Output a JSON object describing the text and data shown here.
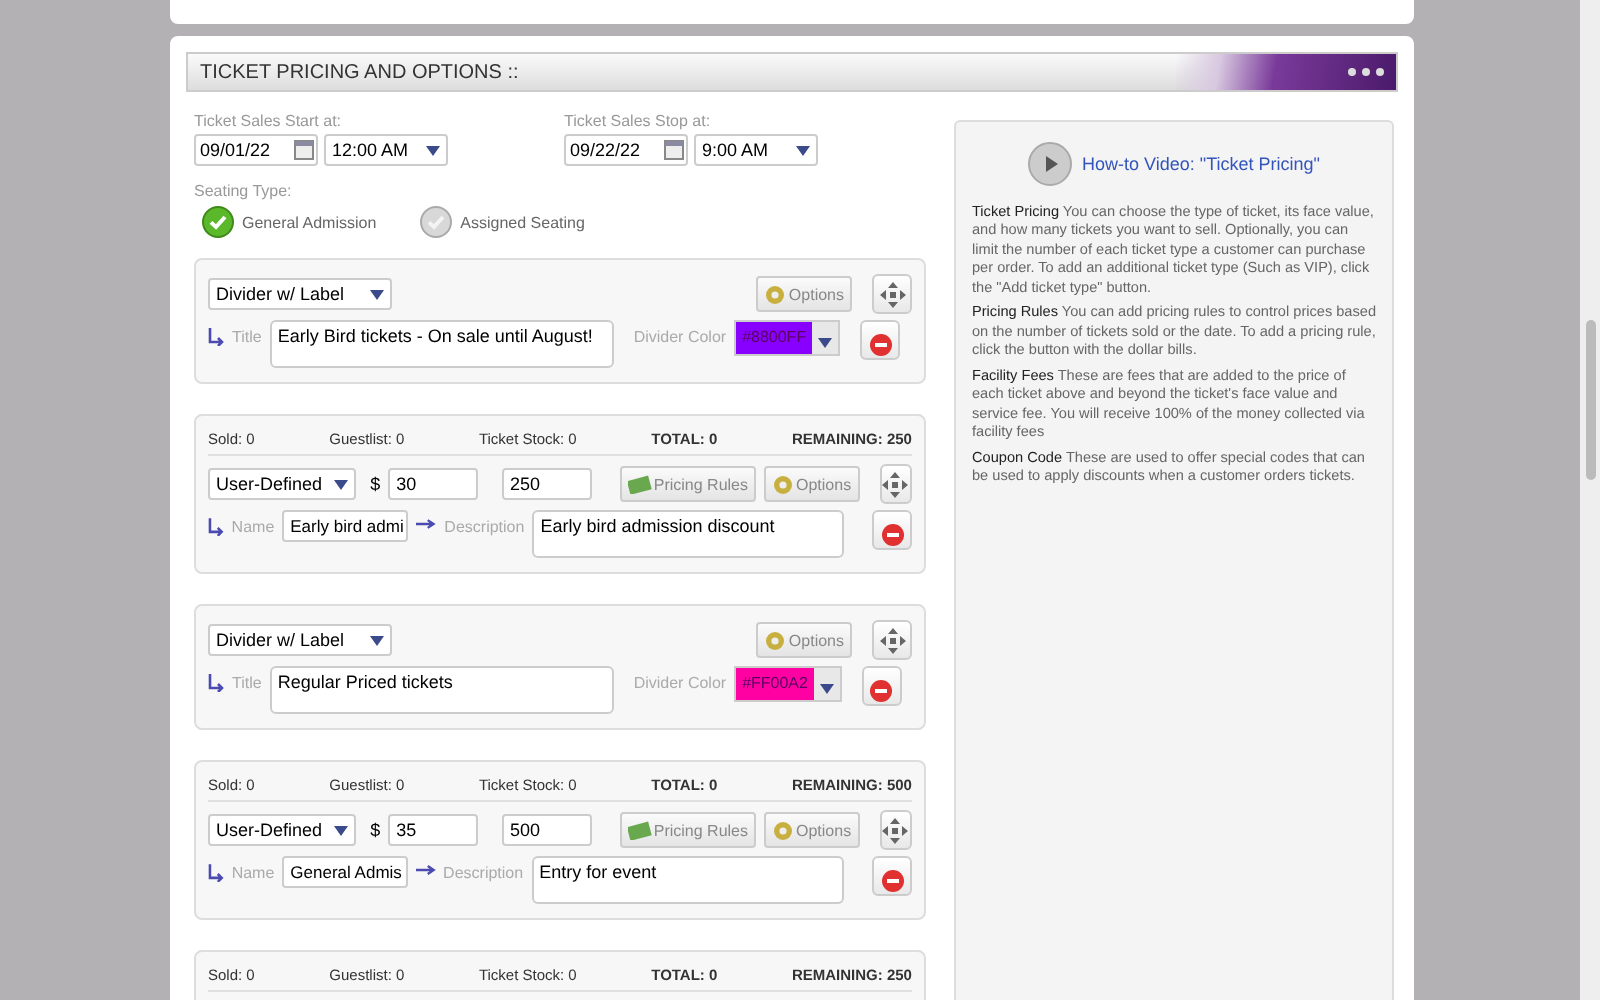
{
  "section": {
    "title": "TICKET PRICING AND OPTIONS ::"
  },
  "sales_start": {
    "label": "Ticket Sales Start at:",
    "date": "09/01/22",
    "time": "12:00 AM"
  },
  "sales_stop": {
    "label": "Ticket Sales Stop at:",
    "date": "09/22/22",
    "time": "9:00 AM"
  },
  "seating": {
    "label": "Seating Type:",
    "options": [
      {
        "label": "General Admission",
        "selected": true
      },
      {
        "label": "Assigned Seating",
        "selected": false
      }
    ]
  },
  "items": [
    {
      "kind": "divider",
      "type": "Divider w/ Label",
      "options_button": "Options",
      "title_label": "Title",
      "title": "Early Bird tickets - On sale until August!",
      "color_label": "Divider Color",
      "color": "#8800ff",
      "color_text": "#8800FF"
    },
    {
      "kind": "ticket",
      "sold": "Sold: 0",
      "guestlist": "Guestlist: 0",
      "stock": "Ticket Stock: 0",
      "total": "TOTAL: 0",
      "remaining": "REMAINING: 250",
      "type": "User-Defined",
      "currency": "$",
      "price": "30",
      "quantity": "250",
      "pricing_button": "Pricing Rules",
      "options_button": "Options",
      "name_label": "Name",
      "name": "Early bird admi",
      "description_label": "Description",
      "description": "Early bird admission discount"
    },
    {
      "kind": "divider",
      "type": "Divider w/ Label",
      "options_button": "Options",
      "title_label": "Title",
      "title": "Regular Priced tickets",
      "color_label": "Divider Color",
      "color": "#ff00a2",
      "color_text": "#FF00A2"
    },
    {
      "kind": "ticket",
      "sold": "Sold: 0",
      "guestlist": "Guestlist: 0",
      "stock": "Ticket Stock: 0",
      "total": "TOTAL: 0",
      "remaining": "REMAINING: 500",
      "type": "User-Defined",
      "currency": "$",
      "price": "35",
      "quantity": "500",
      "pricing_button": "Pricing Rules",
      "options_button": "Options",
      "name_label": "Name",
      "name": "General Admis",
      "description_label": "Description",
      "description": "Entry for event"
    },
    {
      "kind": "ticket",
      "sold": "Sold: 0",
      "guestlist": "Guestlist: 0",
      "stock": "Ticket Stock: 0",
      "total": "TOTAL: 0",
      "remaining": "REMAINING: 250"
    }
  ],
  "help": {
    "video_link": "How-to Video: \"Ticket Pricing\"",
    "paragraphs": [
      "**Ticket Pricing** You can choose the type of ticket, its face value, and how many tickets you want to sell. Optionally, you can limit the number of each ticket type a customer can purchase per order. To add an additional ticket type (Such as VIP), click the \"Add ticket type\" button.",
      "**Pricing Rules** You can add pricing rules to control prices based on the number of tickets sold or the date. To add a pricing rule, click the button with the dollar bills.",
      "**Facility Fees** These are fees that are added to the price of each ticket above and beyond the ticket's face value and service fee. You will receive 100% of the money collected via facility fees",
      "**Coupon Code** These are used to offer special codes that can be used to apply discounts when a customer orders tickets."
    ]
  }
}
